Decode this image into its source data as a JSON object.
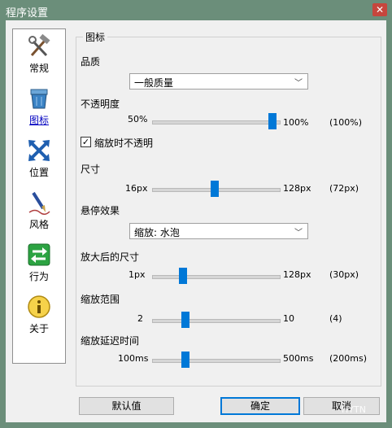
{
  "window": {
    "title": "程序设置",
    "close_glyph": "✕"
  },
  "sidebar": {
    "items": [
      {
        "label": "常规",
        "icon": "tools-icon"
      },
      {
        "label": "图标",
        "icon": "recycle-bin-icon",
        "selected": true
      },
      {
        "label": "位置",
        "icon": "move-arrows-icon"
      },
      {
        "label": "风格",
        "icon": "pen-icon"
      },
      {
        "label": "行为",
        "icon": "switch-arrows-icon"
      },
      {
        "label": "关于",
        "icon": "info-icon"
      }
    ]
  },
  "group": {
    "title": "图标",
    "quality": {
      "label": "品质",
      "value": "一般质量"
    },
    "opacity": {
      "label": "不透明度",
      "min": "50%",
      "max": "100%",
      "current": "(100%)",
      "level": 1.0
    },
    "zoom_opaque": {
      "label": "缩放时不透明",
      "checked": true
    },
    "size": {
      "label": "尺寸",
      "min": "16px",
      "max": "128px",
      "current": "(72px)",
      "level": 0.5
    },
    "hover": {
      "label": "悬停效果",
      "value": "缩放: 水泡"
    },
    "enlarged": {
      "label": "放大后的尺寸",
      "min": "1px",
      "max": "128px",
      "current": "(30px)",
      "level": 0.23
    },
    "zoom_range": {
      "label": "缩放范围",
      "min": "2",
      "max": "10",
      "current": "(4)",
      "level": 0.25
    },
    "zoom_delay": {
      "label": "缩放延迟时间",
      "min": "100ms",
      "max": "500ms",
      "current": "(200ms)",
      "level": 0.25
    }
  },
  "buttons": {
    "default": "默认值",
    "ok": "确定",
    "cancel": "取消"
  },
  "watermark": "HYTN",
  "colors": {
    "accent": "#0078d7",
    "titlebar": "#6b8e7a",
    "close": "#c6463d"
  }
}
